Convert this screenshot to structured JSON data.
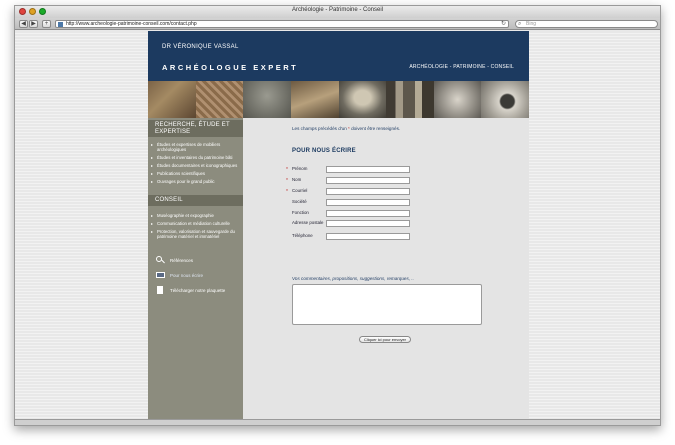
{
  "window": {
    "title": "Archéologie - Patrimoine - Conseil"
  },
  "browser": {
    "back_icon": "back-arrow-icon",
    "forward_icon": "forward-arrow-icon",
    "add_icon": "plus-icon",
    "url": "http://www.archeologie-patrimoine-conseil.com/contact.php",
    "search_placeholder": "Bing"
  },
  "header": {
    "name": "DR VÉRONIQUE VASSAL",
    "title": "ARCHÉOLOGUE EXPERT",
    "nav": "ARCHÉOLOGIE - PATRIMOINE - CONSEIL"
  },
  "sidebar": {
    "section1": {
      "title": "RECHERCHE, ÉTUDE ET EXPERTISE",
      "items": [
        "Études et expertises de mobiliers archéologiques",
        "Études et inventaires du patrimoine bâti",
        "Études documentaires et iconographiques",
        "Publications scientifiques",
        "Ouvrages pour le grand public"
      ]
    },
    "section2": {
      "title": "CONSEIL",
      "items": [
        "Muséographie et expographie",
        "Communication et médiation culturelle",
        "Protection, valorisation et sauvegarde du patrimoine matériel et immatériel"
      ]
    },
    "links": [
      {
        "label": "Références",
        "icon": "magnifier-icon"
      },
      {
        "label": "Pour nous écrire",
        "icon": "envelope-icon"
      },
      {
        "label": "Télécharger notre plaquette",
        "icon": "document-icon"
      }
    ]
  },
  "form": {
    "note_before": "Les champs précédés d'un",
    "note_star": "*",
    "note_after": "doivent être renseignés.",
    "title": "POUR NOUS ÉCRIRE",
    "fields": [
      {
        "label": "Prénom",
        "required": "*"
      },
      {
        "label": "Nom",
        "required": "*"
      },
      {
        "label": "Courriel",
        "required": "*"
      },
      {
        "label": "Société",
        "required": ""
      },
      {
        "label": "Fonction",
        "required": ""
      },
      {
        "label": "Adresse postale",
        "required": ""
      },
      {
        "label": "Téléphone",
        "required": ""
      }
    ],
    "comment_label": "Vos commentaires, propositions, suggestions, remarques, ..",
    "submit": "Cliquer ici pour envoyer"
  }
}
